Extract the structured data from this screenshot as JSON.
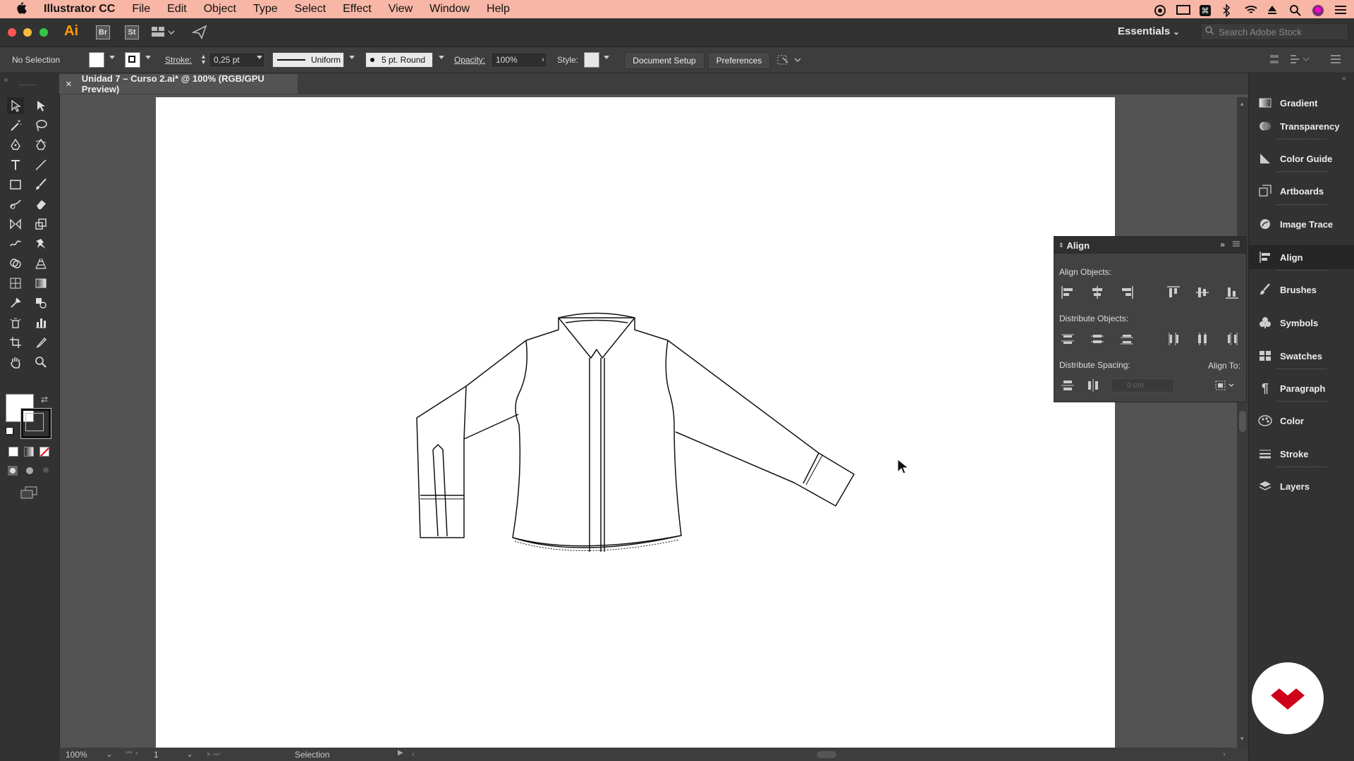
{
  "menubar": {
    "app_name": "Illustrator CC",
    "items": [
      "File",
      "Edit",
      "Object",
      "Type",
      "Select",
      "Effect",
      "View",
      "Window",
      "Help"
    ]
  },
  "appbar": {
    "app_badge": "Ai",
    "bridge_label": "Br",
    "stock_label": "St",
    "workspace": "Essentials",
    "search_placeholder": "Search Adobe Stock"
  },
  "control": {
    "selection_state": "No Selection",
    "stroke_label": "Stroke:",
    "stroke_value": "0,25 pt",
    "stroke_profile": "Uniform",
    "brush": "5 pt. Round",
    "opacity_label": "Opacity:",
    "opacity_value": "100%",
    "style_label": "Style:",
    "document_setup": "Document Setup",
    "preferences": "Preferences"
  },
  "document": {
    "tab_title": "Unidad 7 – Curso 2.ai* @ 100% (RGB/GPU Preview)",
    "close_glyph": "×"
  },
  "status": {
    "zoom": "100%",
    "artboard_number": "1",
    "tool_name": "Selection"
  },
  "align_panel": {
    "title": "Align",
    "align_objects": "Align Objects:",
    "distribute_objects": "Distribute Objects:",
    "distribute_spacing": "Distribute Spacing:",
    "align_to": "Align To:",
    "spacing_value": "0 cm"
  },
  "dock": {
    "items": [
      {
        "label": "Gradient",
        "icon": "gradient-icon"
      },
      {
        "label": "Transparency",
        "icon": "transparency-icon"
      },
      {
        "label": "Color Guide",
        "icon": "color-guide-icon"
      },
      {
        "label": "Artboards",
        "icon": "artboards-icon"
      },
      {
        "label": "Image Trace",
        "icon": "image-trace-icon"
      },
      {
        "label": "Align",
        "icon": "align-icon",
        "active": true
      },
      {
        "label": "Brushes",
        "icon": "brushes-icon"
      },
      {
        "label": "Symbols",
        "icon": "symbols-icon"
      },
      {
        "label": "Swatches",
        "icon": "swatches-icon"
      },
      {
        "label": "Paragraph",
        "icon": "paragraph-icon"
      },
      {
        "label": "Color",
        "icon": "color-icon"
      },
      {
        "label": "Stroke",
        "icon": "stroke-icon"
      },
      {
        "label": "Layers",
        "icon": "layers-icon"
      }
    ]
  },
  "colors": {
    "menubar": "#f7b6a6",
    "app_badge": "#ff9a00",
    "ui_dark": "#323232",
    "canvas": "#535353",
    "artboard": "#ffffff",
    "brand_logo": "#d0021b"
  }
}
